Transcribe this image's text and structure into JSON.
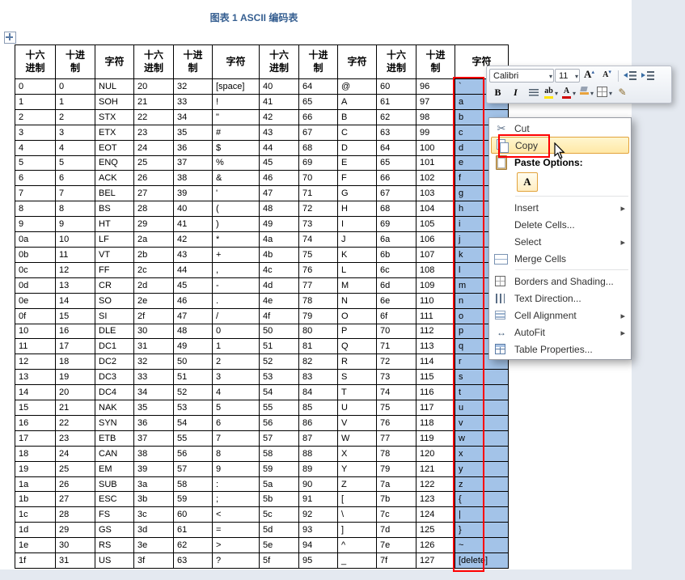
{
  "title": "图表 1 ASCII 编码表",
  "table": {
    "header_labels": [
      "十六\n进制",
      "十进\n制",
      "字符"
    ],
    "rows": [
      [
        "0",
        "0",
        "NUL",
        "20",
        "32",
        "[space]",
        "40",
        "64",
        "@",
        "60",
        "96",
        "`"
      ],
      [
        "1",
        "1",
        "SOH",
        "21",
        "33",
        "!",
        "41",
        "65",
        "A",
        "61",
        "97",
        "a"
      ],
      [
        "2",
        "2",
        "STX",
        "22",
        "34",
        "\"",
        "42",
        "66",
        "B",
        "62",
        "98",
        "b"
      ],
      [
        "3",
        "3",
        "ETX",
        "23",
        "35",
        "#",
        "43",
        "67",
        "C",
        "63",
        "99",
        "c"
      ],
      [
        "4",
        "4",
        "EOT",
        "24",
        "36",
        "$",
        "44",
        "68",
        "D",
        "64",
        "100",
        "d"
      ],
      [
        "5",
        "5",
        "ENQ",
        "25",
        "37",
        "%",
        "45",
        "69",
        "E",
        "65",
        "101",
        "e"
      ],
      [
        "6",
        "6",
        "ACK",
        "26",
        "38",
        "&",
        "46",
        "70",
        "F",
        "66",
        "102",
        "f"
      ],
      [
        "7",
        "7",
        "BEL",
        "27",
        "39",
        "'",
        "47",
        "71",
        "G",
        "67",
        "103",
        "g"
      ],
      [
        "8",
        "8",
        "BS",
        "28",
        "40",
        "(",
        "48",
        "72",
        "H",
        "68",
        "104",
        "h"
      ],
      [
        "9",
        "9",
        "HT",
        "29",
        "41",
        ")",
        "49",
        "73",
        "I",
        "69",
        "105",
        "i"
      ],
      [
        "0a",
        "10",
        "LF",
        "2a",
        "42",
        "*",
        "4a",
        "74",
        "J",
        "6a",
        "106",
        "j"
      ],
      [
        "0b",
        "11",
        "VT",
        "2b",
        "43",
        "+",
        "4b",
        "75",
        "K",
        "6b",
        "107",
        "k"
      ],
      [
        "0c",
        "12",
        "FF",
        "2c",
        "44",
        ",",
        "4c",
        "76",
        "L",
        "6c",
        "108",
        "l"
      ],
      [
        "0d",
        "13",
        "CR",
        "2d",
        "45",
        "-",
        "4d",
        "77",
        "M",
        "6d",
        "109",
        "m"
      ],
      [
        "0e",
        "14",
        "SO",
        "2e",
        "46",
        ".",
        "4e",
        "78",
        "N",
        "6e",
        "110",
        "n"
      ],
      [
        "0f",
        "15",
        "SI",
        "2f",
        "47",
        "/",
        "4f",
        "79",
        "O",
        "6f",
        "111",
        "o"
      ],
      [
        "10",
        "16",
        "DLE",
        "30",
        "48",
        "0",
        "50",
        "80",
        "P",
        "70",
        "112",
        "p"
      ],
      [
        "11",
        "17",
        "DC1",
        "31",
        "49",
        "1",
        "51",
        "81",
        "Q",
        "71",
        "113",
        "q"
      ],
      [
        "12",
        "18",
        "DC2",
        "32",
        "50",
        "2",
        "52",
        "82",
        "R",
        "72",
        "114",
        "r"
      ],
      [
        "13",
        "19",
        "DC3",
        "33",
        "51",
        "3",
        "53",
        "83",
        "S",
        "73",
        "115",
        "s"
      ],
      [
        "14",
        "20",
        "DC4",
        "34",
        "52",
        "4",
        "54",
        "84",
        "T",
        "74",
        "116",
        "t"
      ],
      [
        "15",
        "21",
        "NAK",
        "35",
        "53",
        "5",
        "55",
        "85",
        "U",
        "75",
        "117",
        "u"
      ],
      [
        "16",
        "22",
        "SYN",
        "36",
        "54",
        "6",
        "56",
        "86",
        "V",
        "76",
        "118",
        "v"
      ],
      [
        "17",
        "23",
        "ETB",
        "37",
        "55",
        "7",
        "57",
        "87",
        "W",
        "77",
        "119",
        "w"
      ],
      [
        "18",
        "24",
        "CAN",
        "38",
        "56",
        "8",
        "58",
        "88",
        "X",
        "78",
        "120",
        "x"
      ],
      [
        "19",
        "25",
        "EM",
        "39",
        "57",
        "9",
        "59",
        "89",
        "Y",
        "79",
        "121",
        "y"
      ],
      [
        "1a",
        "26",
        "SUB",
        "3a",
        "58",
        ":",
        "5a",
        "90",
        "Z",
        "7a",
        "122",
        "z"
      ],
      [
        "1b",
        "27",
        "ESC",
        "3b",
        "59",
        ";",
        "5b",
        "91",
        "[",
        "7b",
        "123",
        "{"
      ],
      [
        "1c",
        "28",
        "FS",
        "3c",
        "60",
        "<",
        "5c",
        "92",
        "\\",
        "7c",
        "124",
        "|"
      ],
      [
        "1d",
        "29",
        "GS",
        "3d",
        "61",
        "=",
        "5d",
        "93",
        "]",
        "7d",
        "125",
        "}"
      ],
      [
        "1e",
        "30",
        "RS",
        "3e",
        "62",
        ">",
        "5e",
        "94",
        "^",
        "7e",
        "126",
        "~"
      ],
      [
        "1f",
        "31",
        "US",
        "3f",
        "63",
        "?",
        "5f",
        "95",
        "_",
        "7f",
        "127",
        "[delete]"
      ]
    ]
  },
  "mini_toolbar": {
    "font_name": "Calibri",
    "font_size": "11",
    "grow_font_label": "A",
    "shrink_font_label": "A",
    "bold_label": "B",
    "italic_label": "I",
    "highlight_label": "ab",
    "font_color_label": "A"
  },
  "context_menu": {
    "items": [
      {
        "id": "cut",
        "label": "Cut",
        "icon": "scissors"
      },
      {
        "id": "copy",
        "label": "Copy",
        "icon": "copy",
        "highlighted": true
      },
      {
        "id": "paste-options",
        "label": "Paste Options:",
        "icon": "clipboard",
        "bold": true
      },
      {
        "id": "keep-text-only",
        "type": "paste-option",
        "label": "A"
      },
      {
        "type": "separator"
      },
      {
        "id": "insert",
        "label": "Insert",
        "submenu": true
      },
      {
        "id": "delete-cells",
        "label": "Delete Cells..."
      },
      {
        "id": "select",
        "label": "Select",
        "submenu": true
      },
      {
        "id": "merge-cells",
        "label": "Merge Cells",
        "icon": "merge-cells"
      },
      {
        "type": "separator"
      },
      {
        "id": "borders-and-shading",
        "label": "Borders and Shading...",
        "icon": "borders"
      },
      {
        "id": "text-direction",
        "label": "Text Direction...",
        "icon": "text-direction"
      },
      {
        "id": "cell-alignment",
        "label": "Cell Alignment",
        "submenu": true,
        "icon": "cell-alignment"
      },
      {
        "id": "autofit",
        "label": "AutoFit",
        "submenu": true,
        "icon": "autofit"
      },
      {
        "id": "table-properties",
        "label": "Table Properties...",
        "icon": "table-properties"
      }
    ]
  },
  "colors": {
    "selection_blue": "#a3c3e8",
    "annotation_red": "#ff0000",
    "title_blue": "#365f91",
    "menu_highlight": "#ffe8a6"
  }
}
